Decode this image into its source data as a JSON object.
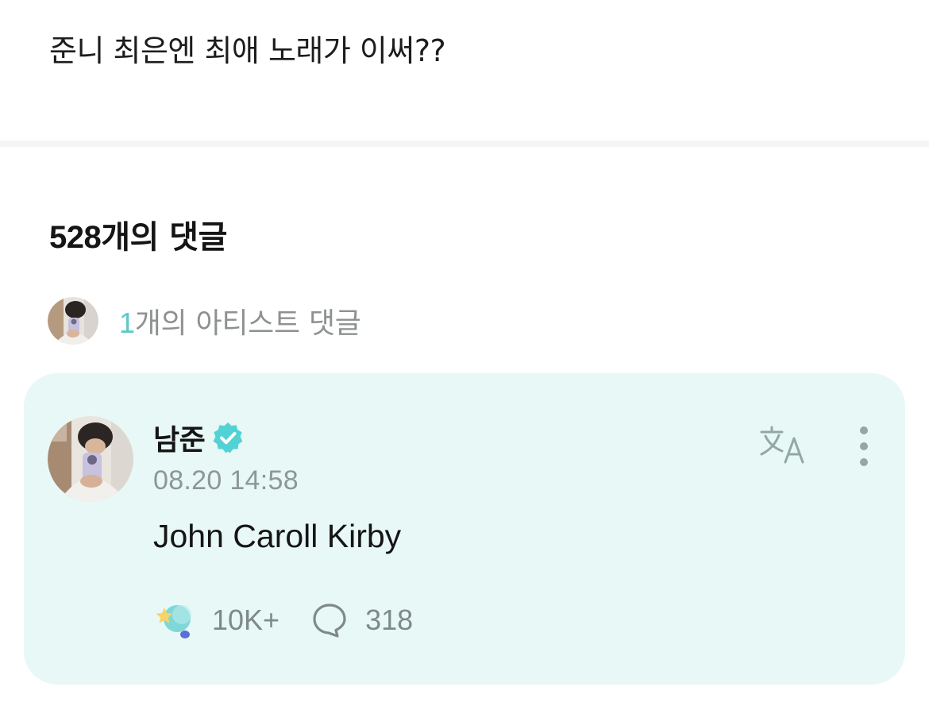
{
  "post": {
    "text": "준니 최은엔 최애 노래가 이써??"
  },
  "comments_header": {
    "count": "528",
    "suffix": "개의 댓글"
  },
  "artist_comments_link": {
    "count": "1",
    "suffix": "개의 아티스트 댓글"
  },
  "comment": {
    "author": "남준",
    "verified": true,
    "timestamp": "08.20 14:58",
    "body": "John Caroll Kirby",
    "like_count": "10K+",
    "reply_count": "318"
  },
  "colors": {
    "accent": "#5cc9c8",
    "card_background": "#e8f8f6",
    "verified_badge": "#52d2d4",
    "muted_text": "#8d9795"
  },
  "icons": {
    "verified": "verified-check-icon",
    "translate": "translate-icon",
    "more": "more-vertical-icon",
    "like": "moon-star-icon",
    "reply": "speech-bubble-icon"
  }
}
